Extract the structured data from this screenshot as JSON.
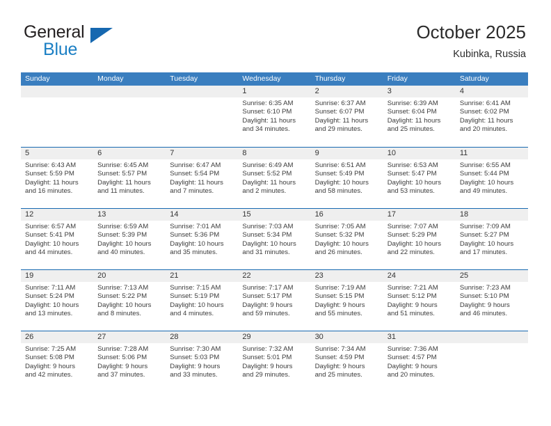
{
  "brand": {
    "name_part1": "General",
    "name_part2": "Blue",
    "logo_icon": "triangle-logo-icon"
  },
  "header": {
    "title": "October 2025",
    "subtitle": "Kubinka, Russia"
  },
  "theme": {
    "header_blue": "#3a7ebf",
    "rule_blue": "#1668b0",
    "band_gray": "#efefef",
    "brand_blue": "#1b7fc4"
  },
  "calendar": {
    "day_names": [
      "Sunday",
      "Monday",
      "Tuesday",
      "Wednesday",
      "Thursday",
      "Friday",
      "Saturday"
    ],
    "weeks": [
      [
        {
          "day": "",
          "empty": true
        },
        {
          "day": "",
          "empty": true
        },
        {
          "day": "",
          "empty": true
        },
        {
          "day": "1",
          "sunrise": "Sunrise: 6:35 AM",
          "sunset": "Sunset: 6:10 PM",
          "daylight1": "Daylight: 11 hours",
          "daylight2": "and 34 minutes."
        },
        {
          "day": "2",
          "sunrise": "Sunrise: 6:37 AM",
          "sunset": "Sunset: 6:07 PM",
          "daylight1": "Daylight: 11 hours",
          "daylight2": "and 29 minutes."
        },
        {
          "day": "3",
          "sunrise": "Sunrise: 6:39 AM",
          "sunset": "Sunset: 6:04 PM",
          "daylight1": "Daylight: 11 hours",
          "daylight2": "and 25 minutes."
        },
        {
          "day": "4",
          "sunrise": "Sunrise: 6:41 AM",
          "sunset": "Sunset: 6:02 PM",
          "daylight1": "Daylight: 11 hours",
          "daylight2": "and 20 minutes."
        }
      ],
      [
        {
          "day": "5",
          "sunrise": "Sunrise: 6:43 AM",
          "sunset": "Sunset: 5:59 PM",
          "daylight1": "Daylight: 11 hours",
          "daylight2": "and 16 minutes."
        },
        {
          "day": "6",
          "sunrise": "Sunrise: 6:45 AM",
          "sunset": "Sunset: 5:57 PM",
          "daylight1": "Daylight: 11 hours",
          "daylight2": "and 11 minutes."
        },
        {
          "day": "7",
          "sunrise": "Sunrise: 6:47 AM",
          "sunset": "Sunset: 5:54 PM",
          "daylight1": "Daylight: 11 hours",
          "daylight2": "and 7 minutes."
        },
        {
          "day": "8",
          "sunrise": "Sunrise: 6:49 AM",
          "sunset": "Sunset: 5:52 PM",
          "daylight1": "Daylight: 11 hours",
          "daylight2": "and 2 minutes."
        },
        {
          "day": "9",
          "sunrise": "Sunrise: 6:51 AM",
          "sunset": "Sunset: 5:49 PM",
          "daylight1": "Daylight: 10 hours",
          "daylight2": "and 58 minutes."
        },
        {
          "day": "10",
          "sunrise": "Sunrise: 6:53 AM",
          "sunset": "Sunset: 5:47 PM",
          "daylight1": "Daylight: 10 hours",
          "daylight2": "and 53 minutes."
        },
        {
          "day": "11",
          "sunrise": "Sunrise: 6:55 AM",
          "sunset": "Sunset: 5:44 PM",
          "daylight1": "Daylight: 10 hours",
          "daylight2": "and 49 minutes."
        }
      ],
      [
        {
          "day": "12",
          "sunrise": "Sunrise: 6:57 AM",
          "sunset": "Sunset: 5:41 PM",
          "daylight1": "Daylight: 10 hours",
          "daylight2": "and 44 minutes."
        },
        {
          "day": "13",
          "sunrise": "Sunrise: 6:59 AM",
          "sunset": "Sunset: 5:39 PM",
          "daylight1": "Daylight: 10 hours",
          "daylight2": "and 40 minutes."
        },
        {
          "day": "14",
          "sunrise": "Sunrise: 7:01 AM",
          "sunset": "Sunset: 5:36 PM",
          "daylight1": "Daylight: 10 hours",
          "daylight2": "and 35 minutes."
        },
        {
          "day": "15",
          "sunrise": "Sunrise: 7:03 AM",
          "sunset": "Sunset: 5:34 PM",
          "daylight1": "Daylight: 10 hours",
          "daylight2": "and 31 minutes."
        },
        {
          "day": "16",
          "sunrise": "Sunrise: 7:05 AM",
          "sunset": "Sunset: 5:32 PM",
          "daylight1": "Daylight: 10 hours",
          "daylight2": "and 26 minutes."
        },
        {
          "day": "17",
          "sunrise": "Sunrise: 7:07 AM",
          "sunset": "Sunset: 5:29 PM",
          "daylight1": "Daylight: 10 hours",
          "daylight2": "and 22 minutes."
        },
        {
          "day": "18",
          "sunrise": "Sunrise: 7:09 AM",
          "sunset": "Sunset: 5:27 PM",
          "daylight1": "Daylight: 10 hours",
          "daylight2": "and 17 minutes."
        }
      ],
      [
        {
          "day": "19",
          "sunrise": "Sunrise: 7:11 AM",
          "sunset": "Sunset: 5:24 PM",
          "daylight1": "Daylight: 10 hours",
          "daylight2": "and 13 minutes."
        },
        {
          "day": "20",
          "sunrise": "Sunrise: 7:13 AM",
          "sunset": "Sunset: 5:22 PM",
          "daylight1": "Daylight: 10 hours",
          "daylight2": "and 8 minutes."
        },
        {
          "day": "21",
          "sunrise": "Sunrise: 7:15 AM",
          "sunset": "Sunset: 5:19 PM",
          "daylight1": "Daylight: 10 hours",
          "daylight2": "and 4 minutes."
        },
        {
          "day": "22",
          "sunrise": "Sunrise: 7:17 AM",
          "sunset": "Sunset: 5:17 PM",
          "daylight1": "Daylight: 9 hours",
          "daylight2": "and 59 minutes."
        },
        {
          "day": "23",
          "sunrise": "Sunrise: 7:19 AM",
          "sunset": "Sunset: 5:15 PM",
          "daylight1": "Daylight: 9 hours",
          "daylight2": "and 55 minutes."
        },
        {
          "day": "24",
          "sunrise": "Sunrise: 7:21 AM",
          "sunset": "Sunset: 5:12 PM",
          "daylight1": "Daylight: 9 hours",
          "daylight2": "and 51 minutes."
        },
        {
          "day": "25",
          "sunrise": "Sunrise: 7:23 AM",
          "sunset": "Sunset: 5:10 PM",
          "daylight1": "Daylight: 9 hours",
          "daylight2": "and 46 minutes."
        }
      ],
      [
        {
          "day": "26",
          "sunrise": "Sunrise: 7:25 AM",
          "sunset": "Sunset: 5:08 PM",
          "daylight1": "Daylight: 9 hours",
          "daylight2": "and 42 minutes."
        },
        {
          "day": "27",
          "sunrise": "Sunrise: 7:28 AM",
          "sunset": "Sunset: 5:06 PM",
          "daylight1": "Daylight: 9 hours",
          "daylight2": "and 37 minutes."
        },
        {
          "day": "28",
          "sunrise": "Sunrise: 7:30 AM",
          "sunset": "Sunset: 5:03 PM",
          "daylight1": "Daylight: 9 hours",
          "daylight2": "and 33 minutes."
        },
        {
          "day": "29",
          "sunrise": "Sunrise: 7:32 AM",
          "sunset": "Sunset: 5:01 PM",
          "daylight1": "Daylight: 9 hours",
          "daylight2": "and 29 minutes."
        },
        {
          "day": "30",
          "sunrise": "Sunrise: 7:34 AM",
          "sunset": "Sunset: 4:59 PM",
          "daylight1": "Daylight: 9 hours",
          "daylight2": "and 25 minutes."
        },
        {
          "day": "31",
          "sunrise": "Sunrise: 7:36 AM",
          "sunset": "Sunset: 4:57 PM",
          "daylight1": "Daylight: 9 hours",
          "daylight2": "and 20 minutes."
        },
        {
          "day": "",
          "empty": true
        }
      ]
    ]
  }
}
